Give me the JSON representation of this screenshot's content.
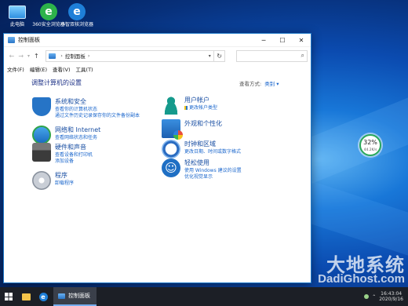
{
  "desktop": {
    "icons": [
      {
        "label": "此电脑",
        "icon": "computer-icon"
      },
      {
        "label": "360安全浏览器",
        "icon": "360-browser-icon"
      },
      {
        "label": "小智双核浏览器",
        "icon": "ie-browser-icon"
      }
    ]
  },
  "window": {
    "title": "控制面板",
    "controls": {
      "minimize": "─",
      "maximize": "☐",
      "close": "✕"
    },
    "address": {
      "segment": "控制面板"
    },
    "menu": [
      "文件(F)",
      "编辑(E)",
      "查看(V)",
      "工具(T)"
    ],
    "heading": "调整计算机的设置",
    "view_by_label": "查看方式:",
    "view_by_value": "类别 ▾",
    "categories": [
      {
        "title": "系统和安全",
        "icon": "shield-icon",
        "links": [
          "查看你的计算机状态",
          "通过文件历史记录保存你的文件备份副本"
        ]
      },
      {
        "title": "网络和 Internet",
        "icon": "network-globe-icon",
        "links": [
          "查看网络状态和任务"
        ]
      },
      {
        "title": "硬件和声音",
        "icon": "printer-icon",
        "links": [
          "查看设备和打印机",
          "添加设备"
        ]
      },
      {
        "title": "程序",
        "icon": "programs-icon",
        "links": [
          "卸载程序"
        ]
      },
      {
        "title": "用户帐户",
        "icon": "user-icon",
        "links": [
          "更改帐户类型"
        ]
      },
      {
        "title": "外观和个性化",
        "icon": "appearance-icon",
        "links": []
      },
      {
        "title": "时钟和区域",
        "icon": "clock-icon",
        "links": [
          "更改日期、时间或数字格式"
        ]
      },
      {
        "title": "轻松使用",
        "icon": "accessibility-icon",
        "links": [
          "使用 Windows 建议的设置",
          "优化视觉显示"
        ]
      }
    ]
  },
  "widget": {
    "percent": "32%",
    "speed": "44.2K/s"
  },
  "watermark": {
    "cn": "大地系统",
    "en": "DadiGhost.com"
  },
  "taskbar": {
    "active_task": "控制面板",
    "clock_time": "16:43:04",
    "clock_date": "2020/9/16"
  }
}
